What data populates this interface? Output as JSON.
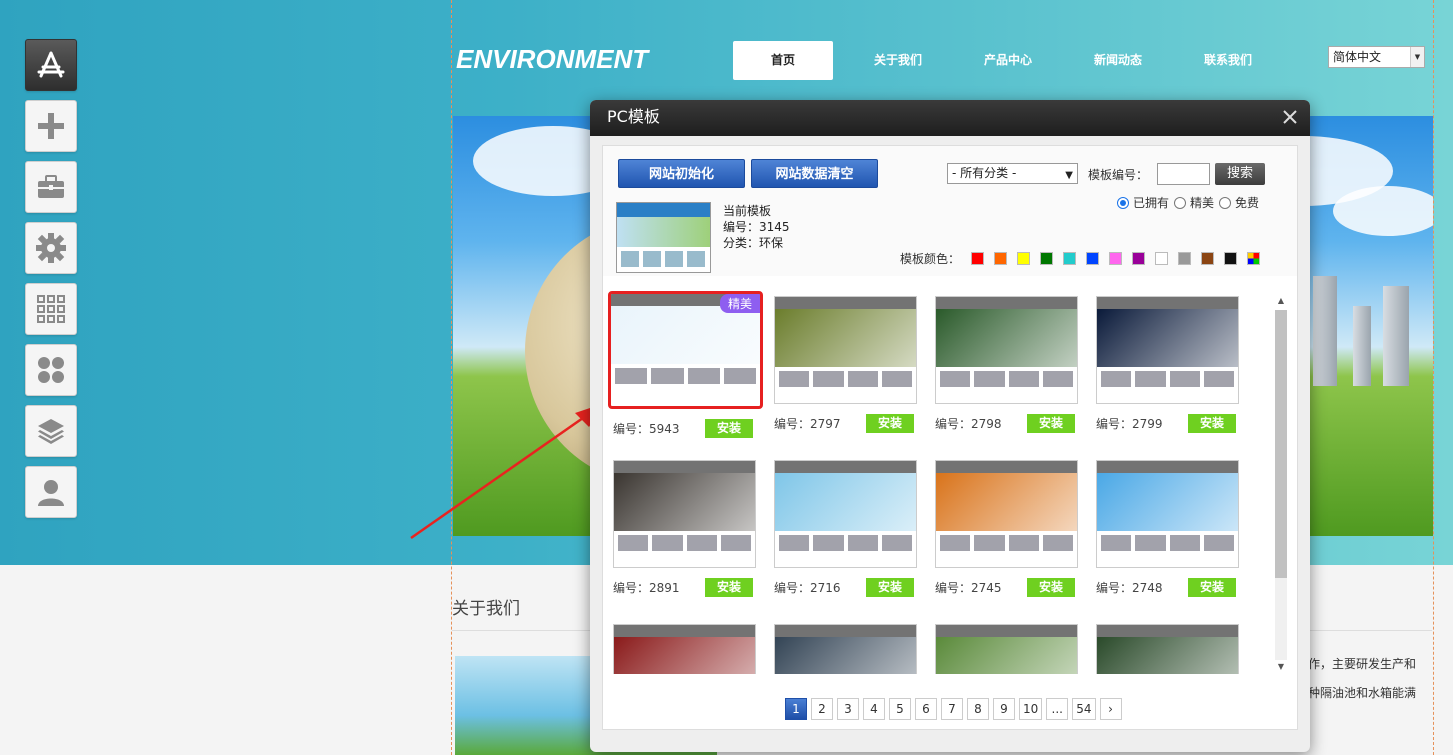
{
  "site": {
    "logo": "ENVIRONMENT",
    "nav": [
      "首页",
      "关于我们",
      "产品中心",
      "新闻动态",
      "联系我们"
    ],
    "language": "简体中文",
    "about_title": "关于我们",
    "about_text_1": "合作，主要研发生产和",
    "about_text_2": "余种隔油池和水箱能满"
  },
  "toolbar": {
    "items": [
      "app-store-icon",
      "plus-icon",
      "toolbox-icon",
      "gear-icon",
      "grid-icon",
      "clover-icon",
      "layers-icon",
      "user-icon"
    ]
  },
  "dialog": {
    "title": "PC模板",
    "btn_init": "网站初始化",
    "btn_clear": "网站数据清空",
    "current_label": "当前模板",
    "current_no": "编号：3145",
    "current_cat": "分类：环保",
    "category_select": "- 所有分类 -",
    "tpl_no_label": "模板编号：",
    "search": "搜索",
    "radios": [
      {
        "label": "已拥有",
        "checked": true
      },
      {
        "label": "精美",
        "checked": false
      },
      {
        "label": "免费",
        "checked": false
      }
    ],
    "color_label": "模板颜色：",
    "colors": [
      "#ff0000",
      "#ff6600",
      "#ffff00",
      "#007700",
      "#22cccc",
      "#0044ff",
      "#ff66ee",
      "#990099",
      "#ffffff",
      "#999999",
      "#8b4513",
      "#111111"
    ],
    "badge": "精美",
    "install": "安装",
    "templates": [
      {
        "no": "编号：5943",
        "theme": "#e9f4fb"
      },
      {
        "no": "编号：2797",
        "theme": "#6b7d2c"
      },
      {
        "no": "编号：2798",
        "theme": "#2a5a2a"
      },
      {
        "no": "编号：2799",
        "theme": "#0a1a3a"
      },
      {
        "no": "编号：2891",
        "theme": "#3a3530"
      },
      {
        "no": "编号：2716",
        "theme": "#7fc6e8"
      },
      {
        "no": "编号：2745",
        "theme": "#d9731a"
      },
      {
        "no": "编号：2748",
        "theme": "#4aa8e6"
      },
      {
        "no": "",
        "theme": "#8a1a1a"
      },
      {
        "no": "",
        "theme": "#334455"
      },
      {
        "no": "",
        "theme": "#5a8a3a"
      },
      {
        "no": "",
        "theme": "#2a4a2a"
      }
    ],
    "pages": [
      "1",
      "2",
      "3",
      "4",
      "5",
      "6",
      "7",
      "8",
      "9",
      "10",
      "...",
      "54"
    ]
  }
}
